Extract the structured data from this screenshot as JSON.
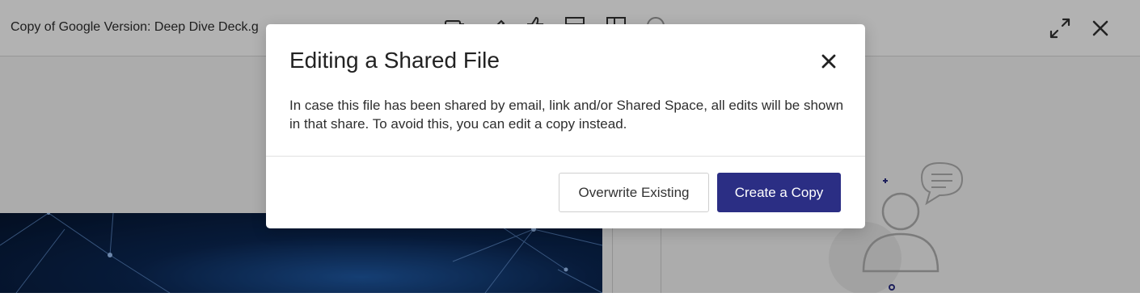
{
  "app": {
    "file_title": "Copy of Google Version: Deep Dive Deck.g",
    "toolbar_icons": [
      "comment-icon",
      "pen-icon",
      "thumbs-up-icon",
      "layout-icon",
      "columns-icon",
      "info-icon"
    ],
    "top_right_icons": [
      "expand-icon",
      "close-icon"
    ]
  },
  "modal": {
    "title": "Editing a Shared File",
    "body": "In case this file has been shared by email, link and/or Shared Space, all edits will be shown in that share. To avoid this, you can edit a copy instead.",
    "close_icon": "close-icon",
    "secondary_button": "Overwrite Existing",
    "primary_button": "Create a Copy"
  },
  "colors": {
    "primary": "#2b2e84",
    "overlay": "rgba(0,0,0,0.30)",
    "text": "#222222"
  }
}
